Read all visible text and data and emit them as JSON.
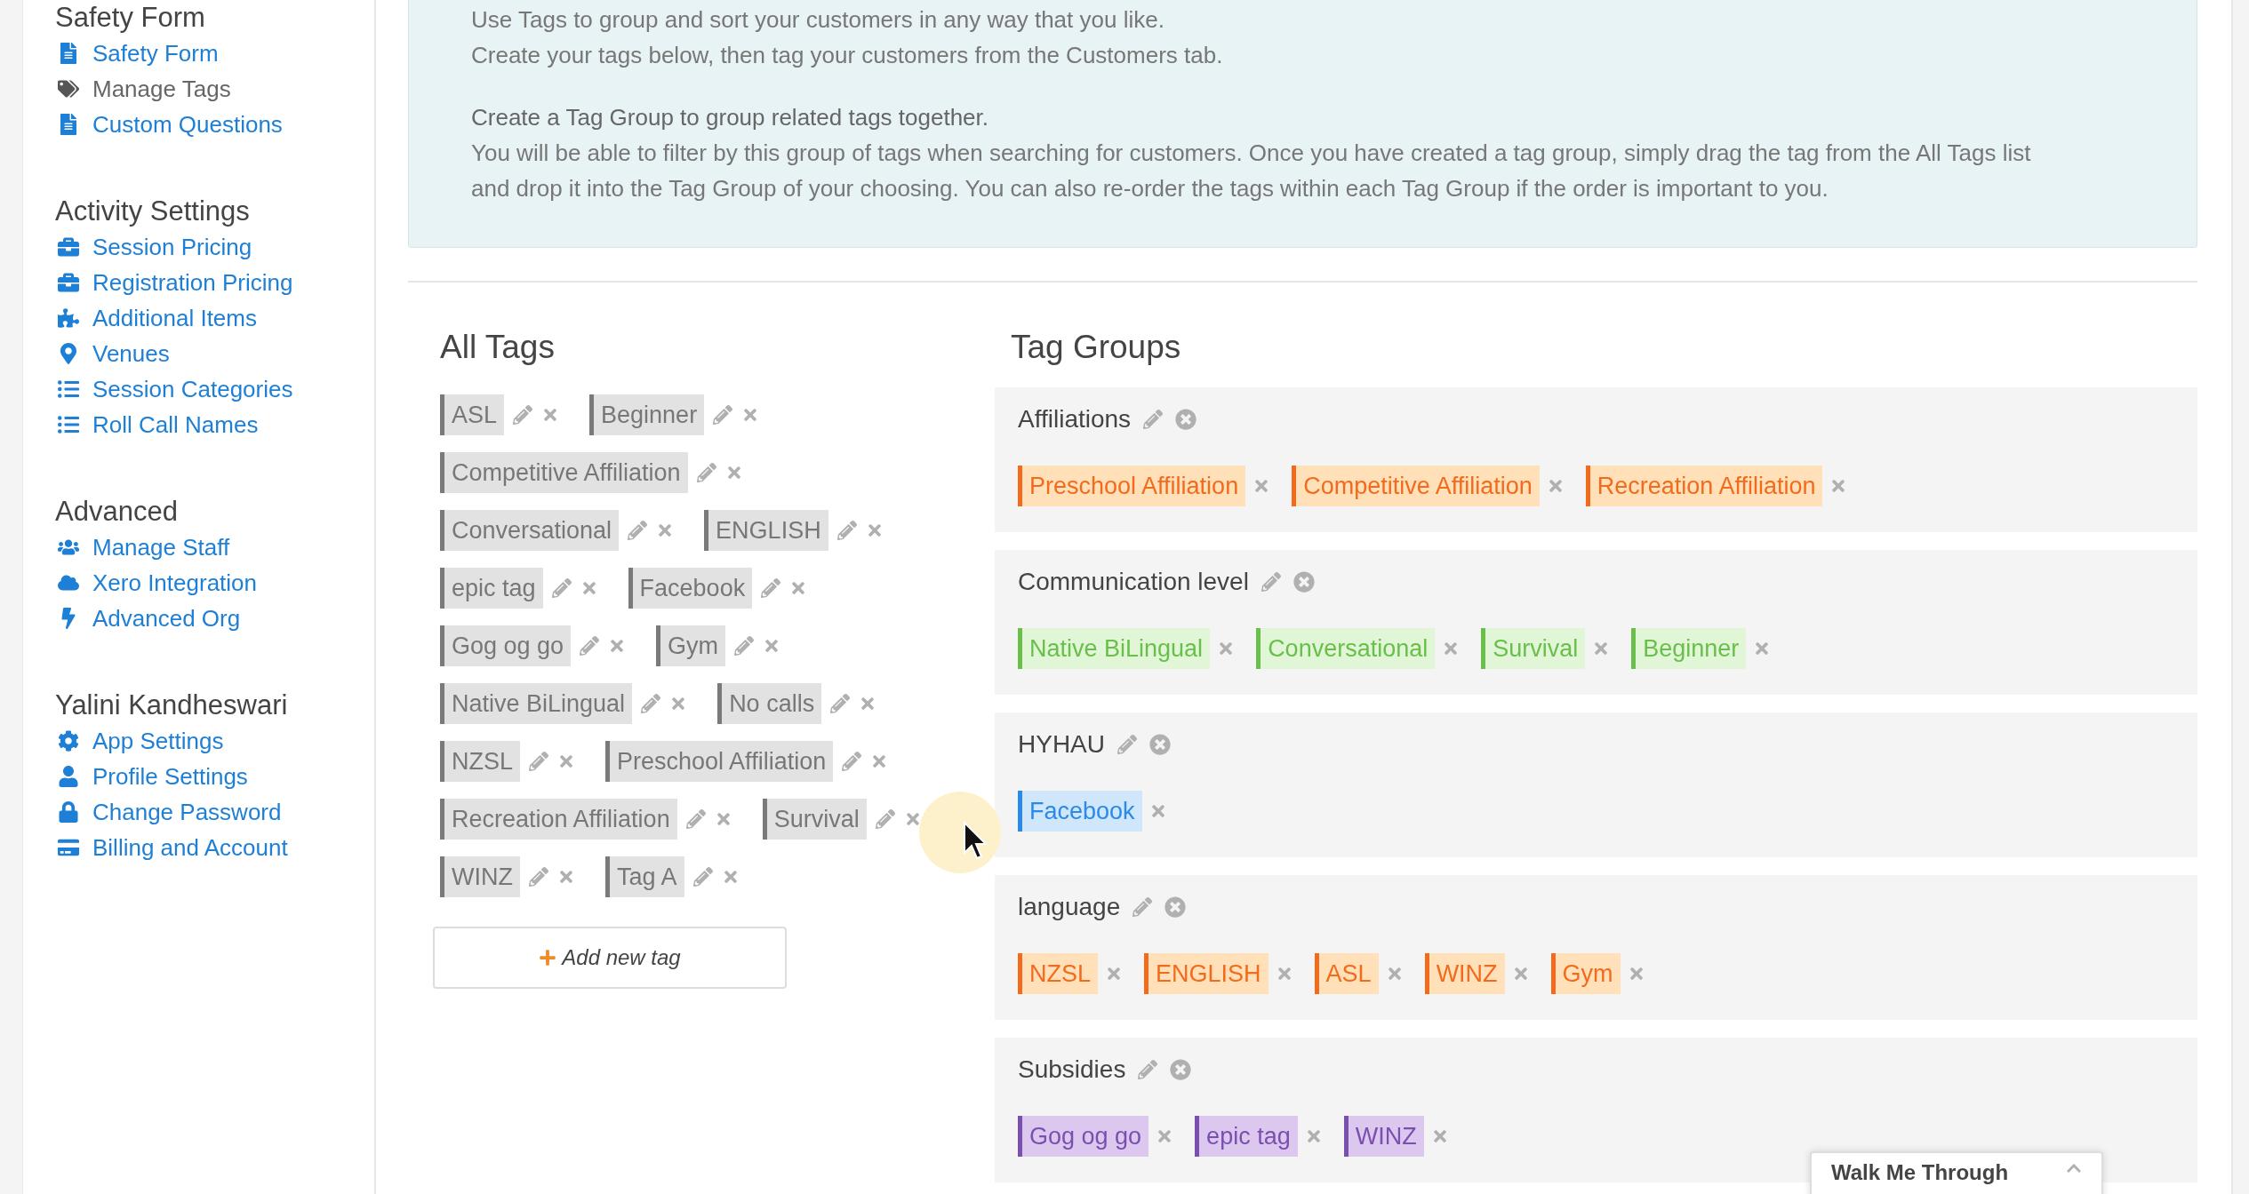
{
  "sidebar": {
    "sections": [
      {
        "title": "Safety Form",
        "items": [
          {
            "label": "Safety Form",
            "selected": false
          },
          {
            "label": "Manage Tags",
            "selected": true
          },
          {
            "label": "Custom Questions",
            "selected": false
          }
        ]
      },
      {
        "title": "Activity Settings",
        "items": [
          {
            "label": "Session Pricing",
            "selected": false
          },
          {
            "label": "Registration Pricing",
            "selected": false
          },
          {
            "label": "Additional Items",
            "selected": false
          },
          {
            "label": "Venues",
            "selected": false
          },
          {
            "label": "Session Categories",
            "selected": false
          },
          {
            "label": "Roll Call Names",
            "selected": false
          }
        ]
      },
      {
        "title": "Advanced",
        "items": [
          {
            "label": "Manage Staff",
            "selected": false
          },
          {
            "label": "Xero Integration",
            "selected": false
          },
          {
            "label": "Advanced Org",
            "selected": false
          }
        ]
      },
      {
        "title": "Yalini Kandheswari",
        "items": [
          {
            "label": "App Settings",
            "selected": false
          },
          {
            "label": "Profile Settings",
            "selected": false
          },
          {
            "label": "Change Password",
            "selected": false
          },
          {
            "label": "Billing and Account",
            "selected": false
          }
        ]
      }
    ]
  },
  "info": {
    "lines": [
      "Use Tags to group and sort your customers in any way that you like.",
      "Create your tags below, then tag your customers from the Customers tab."
    ],
    "heading": "Create a Tag Group to group related tags together.",
    "paragraph": "You will be able to filter by this group of tags when searching for customers. Once you have created a tag group, simply drag the tag from the All Tags list and drop it into the Tag Group of your choosing. You can also re-order the tags within each Tag Group if the order is important to you."
  },
  "all_tags": {
    "title": "All Tags",
    "rows": [
      [
        "ASL",
        "Beginner"
      ],
      [
        "Competitive Affiliation"
      ],
      [
        "Conversational",
        "ENGLISH"
      ],
      [
        "epic tag",
        "Facebook"
      ],
      [
        "Gog og go",
        "Gym"
      ],
      [
        "Native BiLingual",
        "No calls"
      ],
      [
        "NZSL",
        "Preschool Affiliation"
      ],
      [
        "Recreation Affiliation",
        "Survival"
      ],
      [
        "WINZ",
        "Tag A"
      ]
    ],
    "add_button": "Add new tag"
  },
  "tag_groups": {
    "title": "Tag Groups",
    "groups": [
      {
        "name": "Affiliations",
        "color": "#f26b1d",
        "tags": [
          "Preschool Affiliation",
          "Competitive Affiliation",
          "Recreation Affiliation"
        ]
      },
      {
        "name": "Communication level",
        "color": "#6abf4b",
        "tags": [
          "Native BiLingual",
          "Conversational",
          "Survival",
          "Beginner"
        ]
      },
      {
        "name": "HYHAU",
        "color": "#2a8ae6",
        "tags": [
          "Facebook"
        ]
      },
      {
        "name": "language",
        "color": "#f26b1d",
        "tags": [
          "NZSL",
          "ENGLISH",
          "ASL",
          "WINZ",
          "Gym"
        ]
      },
      {
        "name": "Subsidies",
        "color": "#7a4fb0",
        "tags": [
          "Gog og go",
          "epic tag",
          "WINZ"
        ]
      }
    ]
  },
  "walkthrough": {
    "label": "Walk Me Through"
  }
}
